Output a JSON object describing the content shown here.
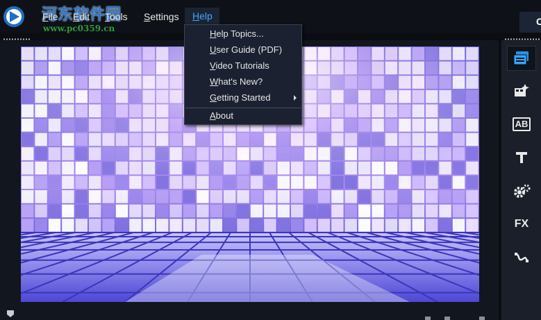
{
  "menubar": {
    "items": [
      {
        "label": "File",
        "underline": "F",
        "rest": "ile"
      },
      {
        "label": "Edit",
        "underline": "E",
        "rest": "dit"
      },
      {
        "label": "Tools",
        "underline": "T",
        "rest": "ools"
      },
      {
        "label": "Settings",
        "underline": "S",
        "rest": "ettings"
      },
      {
        "label": "Help",
        "underline": "H",
        "rest": "elp"
      }
    ],
    "right_tab_label": "C"
  },
  "watermark": {
    "title": "河东软件园",
    "url": "www.pc0359.cn"
  },
  "help_menu": {
    "items": [
      {
        "label": "Help Topics...",
        "u": "H",
        "rest": "elp Topics..."
      },
      {
        "label": "User Guide (PDF)",
        "u": "U",
        "rest": "ser Guide (PDF)"
      },
      {
        "label": "Video Tutorials",
        "u": "V",
        "rest": "ideo Tutorials"
      },
      {
        "label": "What's New?",
        "u": "W",
        "rest": "hat's New?"
      },
      {
        "label": "Getting Started",
        "u": "G",
        "rest": "etting Started"
      },
      {
        "label": "About",
        "u": "A",
        "rest": "bout"
      }
    ]
  },
  "toolbar": {
    "icons": [
      "media-icon",
      "instant-project-icon",
      "title-ab-icon",
      "text-icon",
      "transition-gear-icon",
      "fx-icon",
      "path-icon"
    ],
    "ab_label": "AB",
    "fx_label": "FX"
  },
  "colors": {
    "accent": "#4aa3ff",
    "menu_bg": "#1b2130",
    "background": "#0b0d12"
  }
}
